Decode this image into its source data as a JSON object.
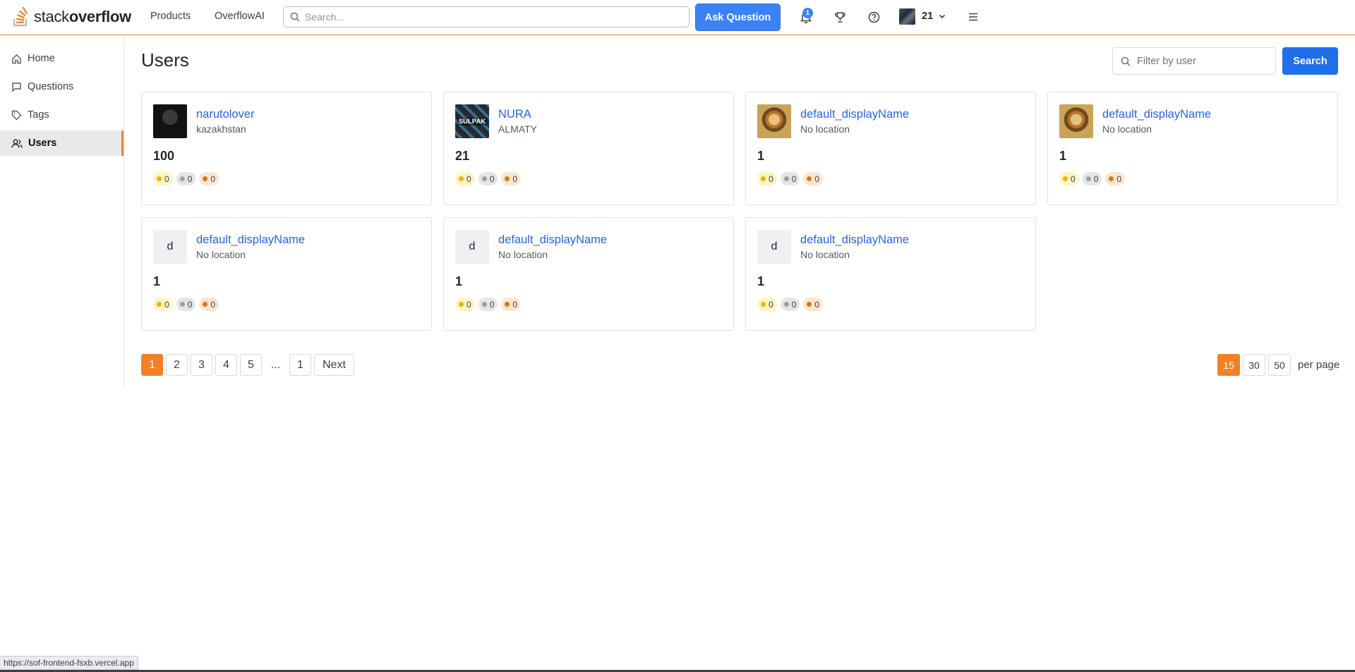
{
  "header": {
    "logo_text_light": "stack",
    "logo_text_bold": "overflow",
    "nav": [
      "Products",
      "OverflowAI"
    ],
    "search_placeholder": "Search...",
    "ask_button": "Ask Question",
    "notification_count": "1",
    "user_reputation": "21"
  },
  "sidebar": {
    "items": [
      {
        "label": "Home",
        "icon": "home-icon"
      },
      {
        "label": "Questions",
        "icon": "chat-icon"
      },
      {
        "label": "Tags",
        "icon": "tag-icon"
      },
      {
        "label": "Users",
        "icon": "users-icon",
        "active": true
      }
    ]
  },
  "main": {
    "title": "Users",
    "filter_placeholder": "Filter by user",
    "search_button": "Search"
  },
  "users": [
    {
      "name": "narutolover",
      "location": "kazakhstan",
      "reputation": "100",
      "gold": "0",
      "silver": "0",
      "bronze": "0",
      "avatar": "photo-dark"
    },
    {
      "name": "NURA",
      "location": "ALMATY",
      "reputation": "21",
      "gold": "0",
      "silver": "0",
      "bronze": "0",
      "avatar": "photo-sulpak",
      "avatar_text": "SULPAK"
    },
    {
      "name": "default_displayName",
      "location": "No location",
      "reputation": "1",
      "gold": "0",
      "silver": "0",
      "bronze": "0",
      "avatar": "photo-painting"
    },
    {
      "name": "default_displayName",
      "location": "No location",
      "reputation": "1",
      "gold": "0",
      "silver": "0",
      "bronze": "0",
      "avatar": "photo-painting"
    },
    {
      "name": "default_displayName",
      "location": "No location",
      "reputation": "1",
      "gold": "0",
      "silver": "0",
      "bronze": "0",
      "avatar": "letter",
      "avatar_letter": "d"
    },
    {
      "name": "default_displayName",
      "location": "No location",
      "reputation": "1",
      "gold": "0",
      "silver": "0",
      "bronze": "0",
      "avatar": "letter",
      "avatar_letter": "d"
    },
    {
      "name": "default_displayName",
      "location": "No location",
      "reputation": "1",
      "gold": "0",
      "silver": "0",
      "bronze": "0",
      "avatar": "letter",
      "avatar_letter": "d"
    }
  ],
  "pagination": {
    "pages": [
      "1",
      "2",
      "3",
      "4",
      "5"
    ],
    "ellipsis": "...",
    "last": "1",
    "next": "Next",
    "current": "1"
  },
  "per_page": {
    "options": [
      "15",
      "30",
      "50"
    ],
    "selected": "15",
    "label": "per page"
  },
  "status_url": "https://sof-frontend-fsxb.vercel.app",
  "colors": {
    "accent": "#f48024",
    "link": "#2563eb",
    "primary_button": "#3b82f6"
  }
}
